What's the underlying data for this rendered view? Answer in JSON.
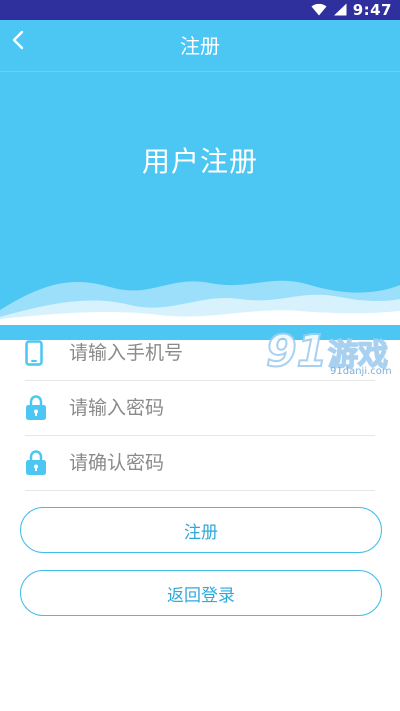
{
  "status_bar": {
    "time": "9:47",
    "icons": [
      "wifi-icon",
      "signal-icon"
    ]
  },
  "header": {
    "back_icon": "chevron-left-icon",
    "title": "注册",
    "hero_title": "用户注册"
  },
  "form": {
    "phone": {
      "icon": "phone-icon",
      "placeholder": "请输入手机号",
      "value": ""
    },
    "password": {
      "icon": "lock-icon",
      "placeholder": "请输入密码",
      "value": ""
    },
    "confirm_password": {
      "icon": "lock-icon",
      "placeholder": "请确认密码",
      "value": ""
    }
  },
  "buttons": {
    "register": "注册",
    "back_to_login": "返回登录"
  },
  "watermark": {
    "number": "91",
    "brand": "游戏",
    "site": "91danji.com"
  },
  "colors": {
    "status_bar": "#2f2f9e",
    "header": "#4cc6f3",
    "accent": "#41bde9",
    "icon": "#4cc6f3"
  }
}
